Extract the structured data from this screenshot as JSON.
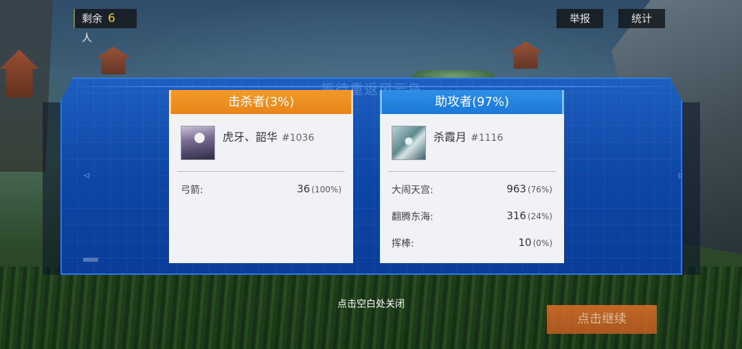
{
  "hud": {
    "remaining_prefix": "剩余",
    "remaining_count": "6",
    "remaining_suffix": "人",
    "report_label": "举报",
    "stats_label": "统计"
  },
  "panel": {
    "ghost_title": "等待重返风云岛",
    "left_arrow": "◁",
    "right_arrow": "▷"
  },
  "killer": {
    "header": "击杀者(3%)",
    "name": "虎牙、韶华",
    "id": "#1036",
    "weapons": [
      {
        "label": "弓箭:",
        "value": "36",
        "pct": "(100%)"
      }
    ]
  },
  "assist": {
    "header": "助攻者(97%)",
    "name": "杀霞月",
    "id": "#1116",
    "skills": [
      {
        "label": "大闹天宫:",
        "value": "963",
        "pct": "(76%)"
      },
      {
        "label": "翻腾东海:",
        "value": "316",
        "pct": "(24%)"
      },
      {
        "label": "挥棒:",
        "value": "10",
        "pct": "(0%)"
      }
    ]
  },
  "footer": {
    "close_hint": "点击空白处关闭",
    "continue_label": "点击继续"
  }
}
